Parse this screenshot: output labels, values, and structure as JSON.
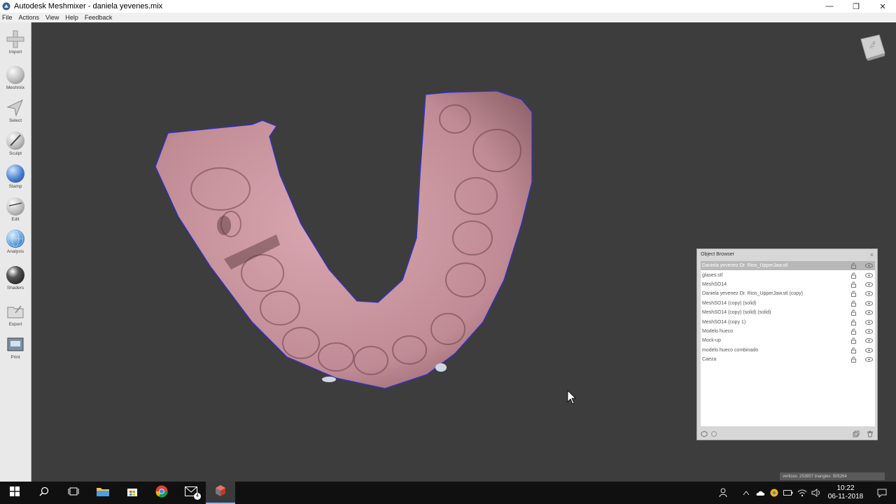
{
  "window": {
    "title": "Autodesk Meshmixer - daniela yevenes.mix",
    "minimize": "—",
    "maximize": "❐",
    "close": "✕"
  },
  "menu": [
    "File",
    "Actions",
    "View",
    "Help",
    "Feedback"
  ],
  "tools": [
    {
      "label": "Import",
      "icon": "plus-icon"
    },
    {
      "label": "Meshmix",
      "icon": "meshmix-sphere-icon"
    },
    {
      "label": "Select",
      "icon": "select-arrow-icon"
    },
    {
      "label": "Sculpt",
      "icon": "sculpt-brush-icon"
    },
    {
      "label": "Stamp",
      "icon": "stamp-sphere-icon"
    },
    {
      "label": "Edit",
      "icon": "edit-sphere-icon"
    },
    {
      "label": "Analysis",
      "icon": "analysis-mesh-icon"
    },
    {
      "label": "Shaders",
      "icon": "shaders-sphere-icon"
    },
    {
      "label": "Export",
      "icon": "export-folder-icon"
    },
    {
      "label": "Print",
      "icon": "print-icon"
    }
  ],
  "viewcube": {
    "face": "TOP"
  },
  "stats": "vertices: 253857  triangles: 505264",
  "object_browser": {
    "title": "Object Browser",
    "close": "×",
    "items": [
      {
        "name": "Daniela yevenez Dr. Rios_UpperJaw.stl",
        "selected": true
      },
      {
        "name": "glases.stl",
        "selected": false
      },
      {
        "name": "MeshSO14",
        "selected": false
      },
      {
        "name": "Daniela yevenez Dr. Rios_UpperJaw.stl (copy)",
        "selected": false
      },
      {
        "name": "MeshSO14 (copy) (solid)",
        "selected": false
      },
      {
        "name": "MeshSO14 (copy) (solid) (solid)",
        "selected": false
      },
      {
        "name": "MeshSO14 (copy 1)",
        "selected": false
      },
      {
        "name": "Modelo hueco",
        "selected": false
      },
      {
        "name": "Mock-up",
        "selected": false
      },
      {
        "name": "modelo hueco combinado",
        "selected": false
      },
      {
        "name": "Caeza",
        "selected": false
      }
    ]
  },
  "colors": {
    "viewport": "#3d3d3d",
    "mesh": "#c9959e",
    "outline": "#2a2ad0",
    "taskbar": "#101010"
  },
  "taskbar": {
    "mail_badge": "4",
    "time": "10:22",
    "date": "06-11-2018"
  }
}
